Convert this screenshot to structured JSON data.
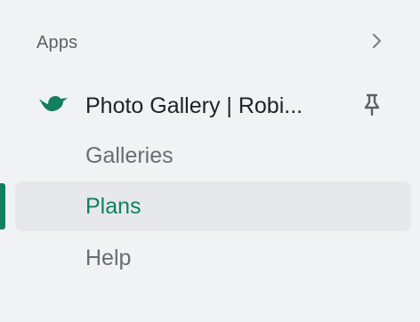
{
  "sidebar": {
    "section_title": "Apps",
    "app": {
      "name": "Photo Gallery | Robi..."
    },
    "items": [
      {
        "label": "Galleries",
        "active": false
      },
      {
        "label": "Plans",
        "active": true
      },
      {
        "label": "Help",
        "active": false
      }
    ]
  },
  "colors": {
    "accent": "#12805c",
    "background": "#f1f2f3",
    "active_bg": "#e7e8eb",
    "text_primary": "#202227",
    "text_secondary": "#686d75"
  },
  "icons": {
    "expand": "chevron-right-icon",
    "app_logo": "bird-icon",
    "pin": "pin-icon"
  }
}
